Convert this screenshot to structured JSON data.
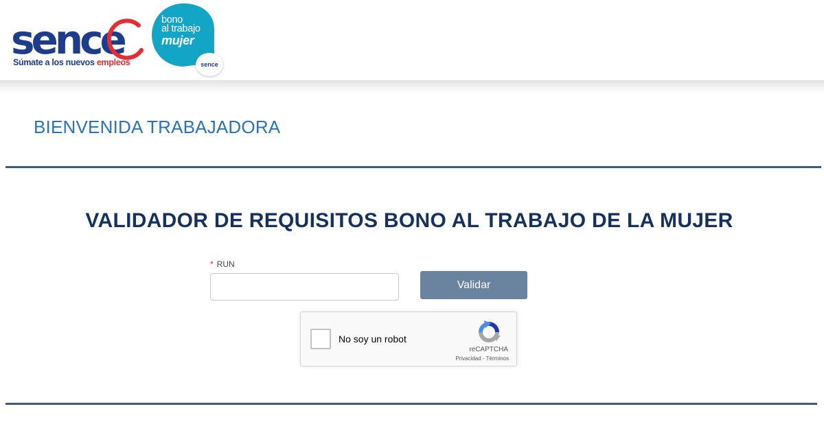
{
  "header": {
    "sence_logo": {
      "wordmark": "sence",
      "tagline_prefix": "Súmate a los nuevos ",
      "tagline_highlight": "empleos",
      "brand_color": "#1e3c8c",
      "accent_color": "#e42d35"
    },
    "bono_logo": {
      "line1": "bono",
      "line2": "al trabajo",
      "line3": "mujer",
      "badge_text": "sence",
      "color": "#13a5c6"
    }
  },
  "welcome": {
    "title": "BIENVENIDA TRABAJADORA"
  },
  "main": {
    "title": "VALIDADOR DE REQUISITOS BONO AL TRABAJO DE LA MUJER",
    "run": {
      "required_mark": "*",
      "label": "RUN",
      "value": "",
      "placeholder": ""
    },
    "validate_button": "Validar"
  },
  "recaptcha": {
    "label": "No soy un robot",
    "brand": "reCAPTCHA",
    "links": "Privacidad - Términos",
    "icon": "recaptcha-icon"
  },
  "colors": {
    "title_blue": "#16325c",
    "welcome_blue": "#2a73b6",
    "divider": "#3f5a7f",
    "button": "#6a84a0"
  }
}
